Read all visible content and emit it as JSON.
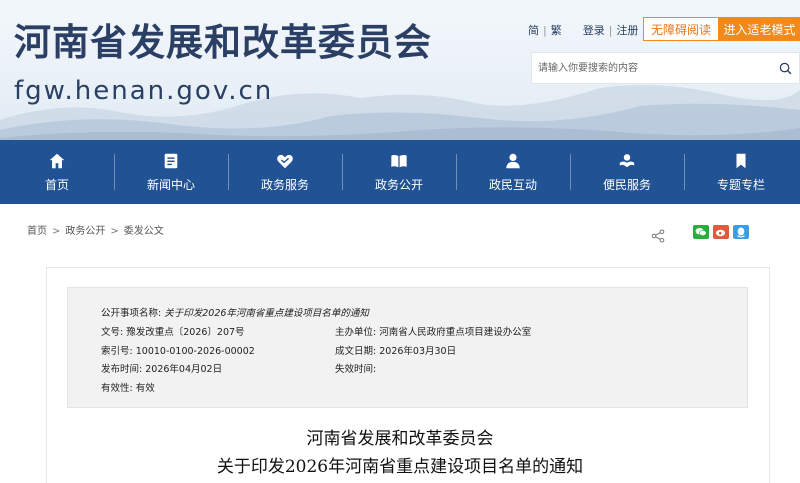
{
  "header": {
    "title": "河南省发展和改革委员会",
    "domain": "fgw.henan.gov.cn",
    "links": {
      "simplified": "简",
      "traditional": "繁",
      "login": "登录",
      "register": "注册"
    },
    "accessible_label": "无障碍阅读",
    "elder_label": "进入适老模式",
    "search_placeholder": "请输入你要搜索的内容"
  },
  "nav": {
    "items": [
      {
        "label": "首页",
        "icon": "home-icon"
      },
      {
        "label": "新闻中心",
        "icon": "news-icon"
      },
      {
        "label": "政务服务",
        "icon": "service-icon"
      },
      {
        "label": "政务公开",
        "icon": "book-icon"
      },
      {
        "label": "政民互动",
        "icon": "user-icon"
      },
      {
        "label": "便民服务",
        "icon": "hands-icon"
      },
      {
        "label": "专题专栏",
        "icon": "bookmark-icon"
      }
    ]
  },
  "breadcrumb": {
    "items": [
      "首页",
      "政务公开",
      "委发公文"
    ],
    "separator": ">"
  },
  "meta": {
    "item_name_label": "公开事项名称:",
    "item_name": "关于印发2026年河南省重点建设项目名单的通知",
    "doc_no_label": "文号:",
    "doc_no": "豫发改重点〔2026〕207号",
    "org_label": "主办单位:",
    "org": "河南省人民政府重点项目建设办公室",
    "index_label": "索引号:",
    "index": "10010-0100-2026-00002",
    "date_label": "成文日期:",
    "date": "2026年03月30日",
    "publish_label": "发布时间:",
    "publish": "2026年04月02日",
    "expire_label": "失效时间:",
    "expire": "",
    "valid_label": "有效性:",
    "valid": "有效"
  },
  "document": {
    "title_line1": "河南省发展和改革委员会",
    "title_line2": "关于印发2026年河南省重点建设项目名单的通知"
  },
  "colors": {
    "nav_bg": "#215394",
    "title": "#2a3f63",
    "accent_orange": "#f08a1c"
  }
}
